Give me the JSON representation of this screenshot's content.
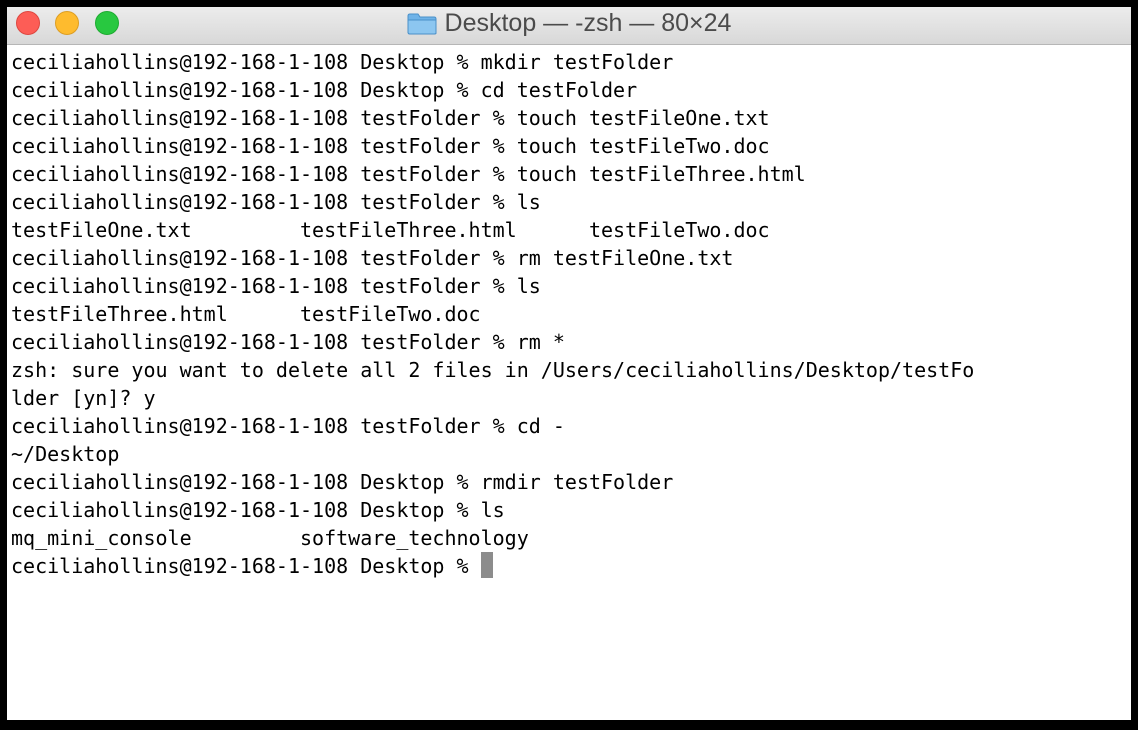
{
  "window": {
    "title": "Desktop — -zsh — 80×24",
    "title_icon": "folder-icon",
    "controls": [
      "close",
      "minimize",
      "zoom"
    ]
  },
  "colors": {
    "close": "#fd5d56",
    "minimize": "#febb2e",
    "zoom": "#28c840",
    "cursor": "#8c8c8c"
  },
  "terminal": {
    "lines": [
      "ceciliahollins@192-168-1-108 Desktop % mkdir testFolder",
      "ceciliahollins@192-168-1-108 Desktop % cd testFolder",
      "ceciliahollins@192-168-1-108 testFolder % touch testFileOne.txt",
      "ceciliahollins@192-168-1-108 testFolder % touch testFileTwo.doc",
      "ceciliahollins@192-168-1-108 testFolder % touch testFileThree.html",
      "ceciliahollins@192-168-1-108 testFolder % ls",
      "testFileOne.txt         testFileThree.html      testFileTwo.doc",
      "ceciliahollins@192-168-1-108 testFolder % rm testFileOne.txt",
      "ceciliahollins@192-168-1-108 testFolder % ls",
      "testFileThree.html      testFileTwo.doc",
      "ceciliahollins@192-168-1-108 testFolder % rm *",
      "zsh: sure you want to delete all 2 files in /Users/ceciliahollins/Desktop/testFo",
      "lder [yn]? y",
      "ceciliahollins@192-168-1-108 testFolder % cd -",
      "~/Desktop",
      "ceciliahollins@192-168-1-108 Desktop % rmdir testFolder",
      "ceciliahollins@192-168-1-108 Desktop % ls",
      "mq_mini_console         software_technology"
    ],
    "prompt": "ceciliahollins@192-168-1-108 Desktop % "
  }
}
